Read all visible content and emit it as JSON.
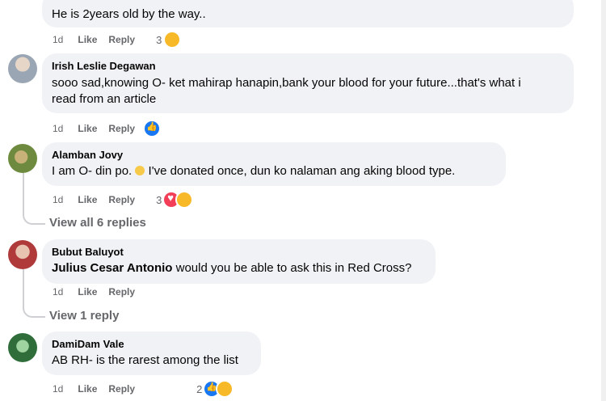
{
  "comments": [
    {
      "author": "",
      "text": "He is 2years old by the way..",
      "time": "1d",
      "like": "Like",
      "reply": "Reply",
      "reaction_count": "3"
    },
    {
      "author": "Irish Leslie Degawan",
      "text_line1": "sooo sad,knowing O- ket mahirap hanapin,bank your blood for your future...that's what i",
      "text_line2": "read from an article",
      "time": "1d",
      "like": "Like",
      "reply": "Reply",
      "reaction_count": ""
    },
    {
      "author": "Alamban Jovy",
      "text_before": "I am O- din po. ",
      "text_after": " I've donated once, dun ko nalaman ang aking blood type.",
      "time": "1d",
      "like": "Like",
      "reply": "Reply",
      "reaction_count": "3"
    },
    {
      "author": "Bubut Baluyot",
      "mention": "Julius Cesar Antonio",
      "text": " would you be able to ask this in Red Cross?",
      "time": "1d",
      "like": "Like",
      "reply": "Reply"
    },
    {
      "author": "DamiDam Vale",
      "text": "AB RH- is the rarest among the list",
      "time": "1d",
      "like": "Like",
      "reply": "Reply",
      "reaction_count": "2"
    }
  ],
  "view_all_replies": "View all 6 replies",
  "view_one_reply": "View 1 reply",
  "colors": {
    "bubble": "#f0f2f5",
    "meta_text": "#65676b",
    "like_blue": "#1877f2",
    "love_red": "#f33e58",
    "care_yellow": "#f7b928"
  },
  "icons": [
    "like-reaction-icon",
    "love-reaction-icon",
    "care-reaction-icon",
    "worried-face-emoji-icon"
  ]
}
